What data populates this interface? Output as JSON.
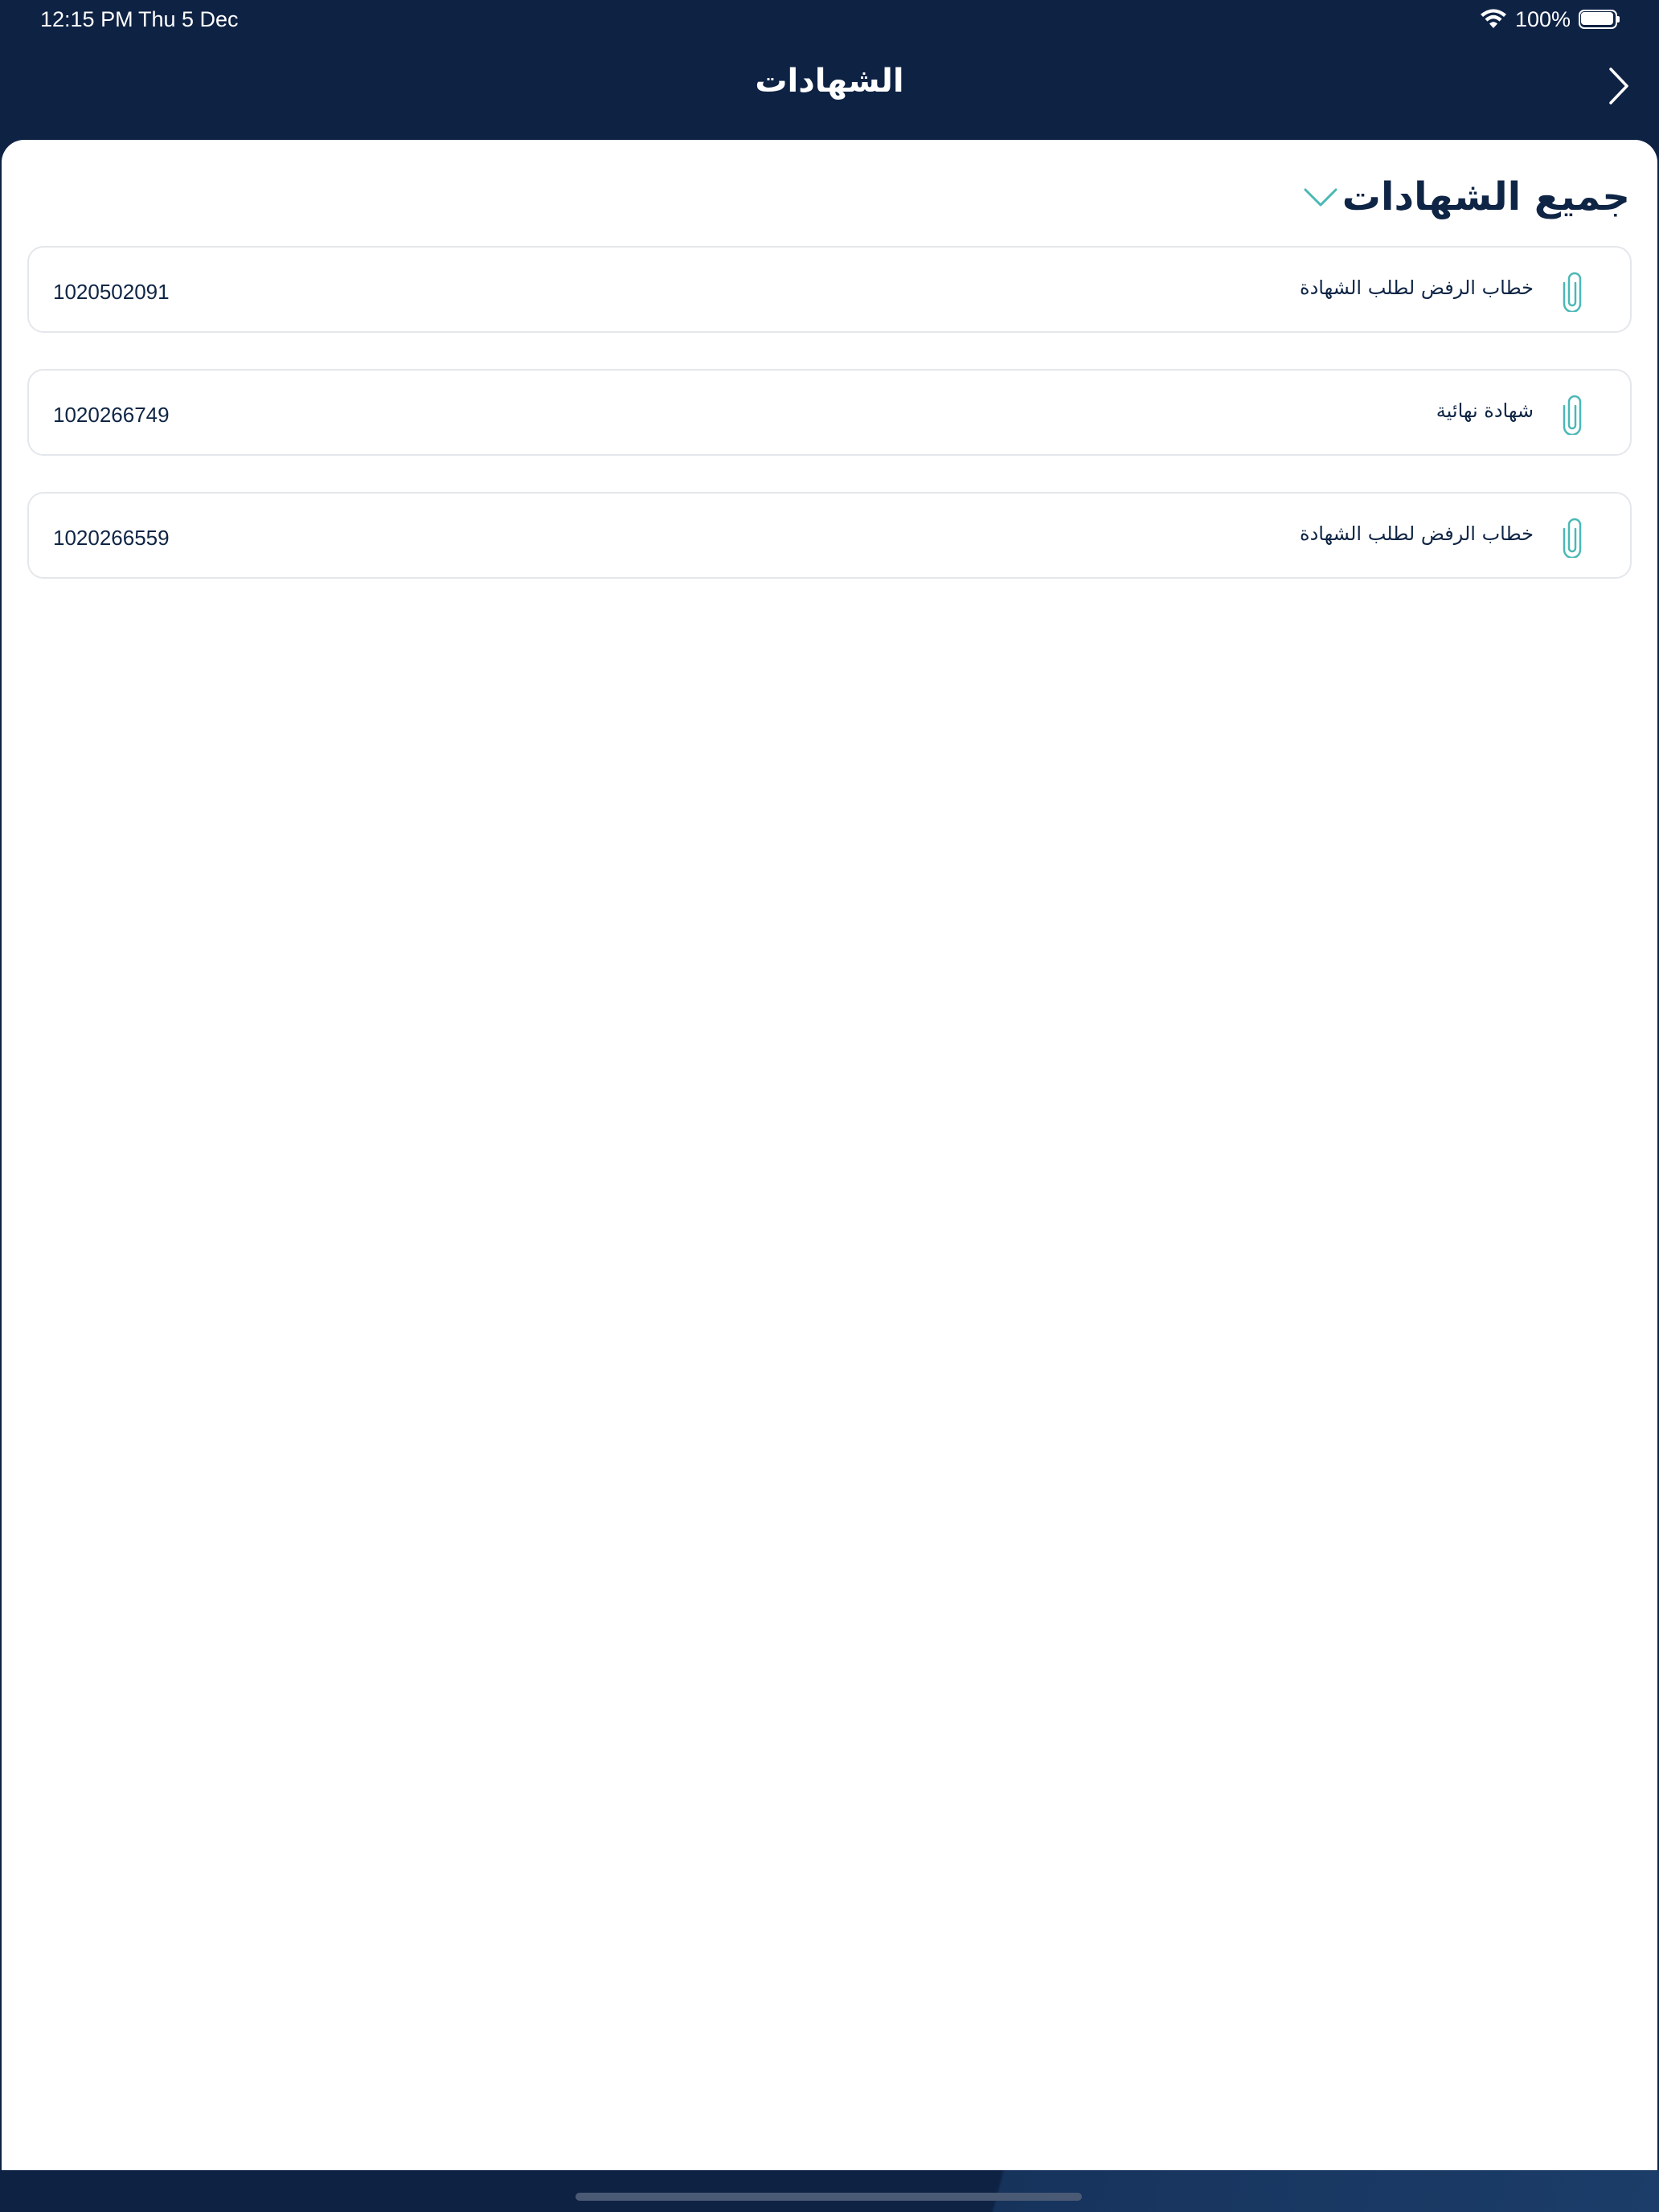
{
  "status_bar": {
    "time": "12:15 PM",
    "date": "Thu 5 Dec",
    "battery_percent": "100%"
  },
  "nav": {
    "title": "الشهادات",
    "back_icon": "chevron-right-icon"
  },
  "filter": {
    "label": "جميع الشهادات",
    "icon": "chevron-down-icon"
  },
  "certificates": [
    {
      "title": "خطاب الرفض لطلب الشهادة",
      "number": "1020502091",
      "icon": "paperclip-icon"
    },
    {
      "title": "شهادة نهائية",
      "number": "1020266749",
      "icon": "paperclip-icon"
    },
    {
      "title": "خطاب الرفض لطلب الشهادة",
      "number": "1020266559",
      "icon": "paperclip-icon"
    }
  ],
  "colors": {
    "header_bg": "#0e2244",
    "text_primary": "#0f2545",
    "accent": "#4bb8b5",
    "card_border": "#e4e7eb"
  }
}
